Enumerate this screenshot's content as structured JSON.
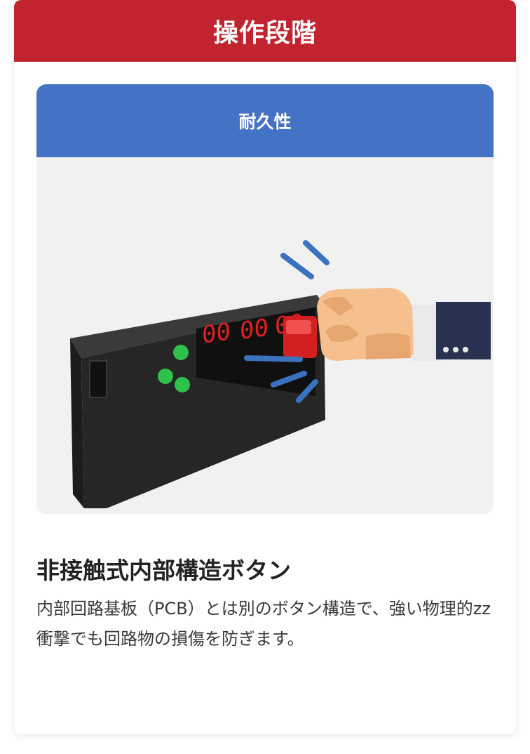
{
  "card": {
    "header": "操作段階",
    "panel_header": "耐久性",
    "title": "非接触式内部構造ボタン",
    "description": "内部回路基板（PCB）とは別のボタン構造で、強い物理的zz衝撃でも回路物の損傷を防ぎます。"
  },
  "illustration": {
    "display_digits": [
      "00",
      "00",
      "00"
    ],
    "icons": [
      "display-unit-icon",
      "fist-press-icon",
      "impact-lines-icon"
    ]
  },
  "colors": {
    "header_red": "#c1242e",
    "panel_blue": "#4472c4",
    "led_green": "#2ec24a",
    "digit_red": "#e02020"
  }
}
